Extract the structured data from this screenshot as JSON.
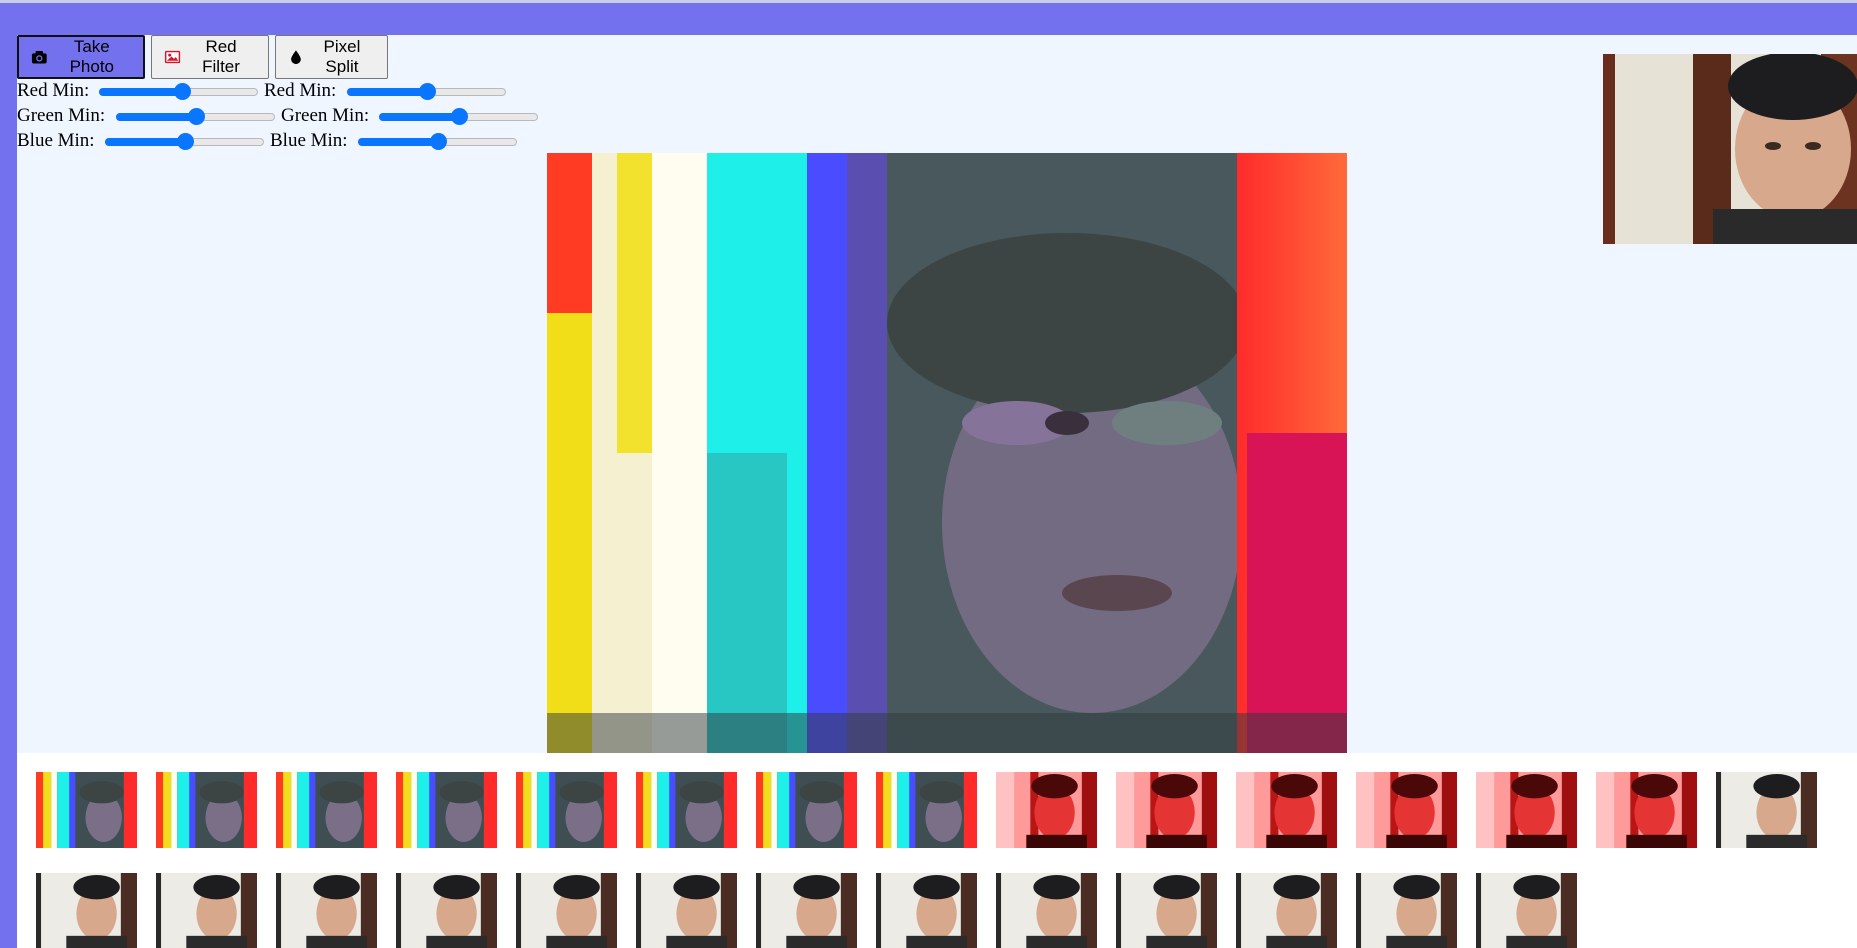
{
  "toolbar": {
    "take_photo_label": "Take Photo",
    "red_filter_label": "Red Filter",
    "pixel_split_label": "Pixel Split"
  },
  "controls": [
    {
      "left_label": "Red Min:",
      "left_value": 0.52,
      "right_label": "Red Min:",
      "right_value": 0.5
    },
    {
      "left_label": "Green Min:",
      "left_value": 0.5,
      "right_label": "Green Min:",
      "right_value": 0.5
    },
    {
      "left_label": "Blue Min:",
      "left_value": 0.5,
      "right_label": "Blue Min:",
      "right_value": 0.5
    }
  ],
  "colors": {
    "accent": "#7471ef",
    "panel": "#eff6ff",
    "slider": "#0a75ff"
  },
  "icons": {
    "take_photo": "camera-icon",
    "red_filter": "image-icon",
    "pixel_split": "droplet-icon"
  },
  "strip": {
    "row1": [
      "rgb-split",
      "rgb-split",
      "rgb-split",
      "rgb-split",
      "rgb-split",
      "rgb-split",
      "rgb-split",
      "rgb-split",
      "red",
      "red",
      "red",
      "red",
      "red",
      "red",
      "normal"
    ],
    "row2": [
      "normal",
      "normal",
      "normal",
      "normal",
      "normal",
      "normal",
      "normal",
      "normal",
      "normal",
      "normal",
      "normal",
      "normal",
      "normal"
    ]
  }
}
